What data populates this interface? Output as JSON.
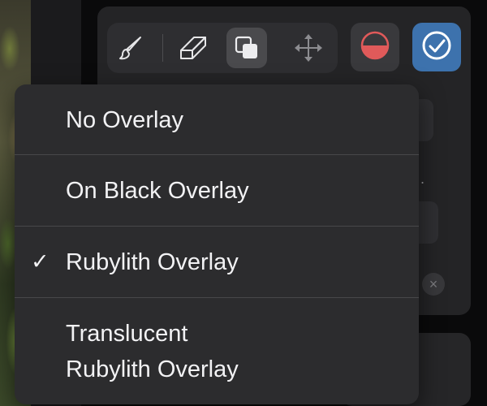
{
  "toolbar": {
    "tools": [
      {
        "icon": "brush-icon",
        "active": false
      },
      {
        "icon": "eraser-icon",
        "active": false
      },
      {
        "icon": "overlay-layers-icon",
        "active": true
      },
      {
        "icon": "move-arrows-icon",
        "active": false
      }
    ],
    "mask_button_icon": "half-circle-mask-icon",
    "confirm_button_icon": "checkmark-circle-icon"
  },
  "colors": {
    "accent_blue": "#3d72ad",
    "mask_red": "#e05a5a",
    "menu_background": "#2c2c2e",
    "separator": "#48484a"
  },
  "panel": {
    "truncated_text": ":."
  },
  "overlay_menu": {
    "items": [
      {
        "label": "No Overlay",
        "checked": false
      },
      {
        "label": "On Black Overlay",
        "checked": false
      },
      {
        "label": "Rubylith Overlay",
        "checked": true
      },
      {
        "label_line1": "Translucent",
        "label_line2": "Rubylith Overlay",
        "checked": false
      }
    ],
    "check_glyph": "✓"
  }
}
